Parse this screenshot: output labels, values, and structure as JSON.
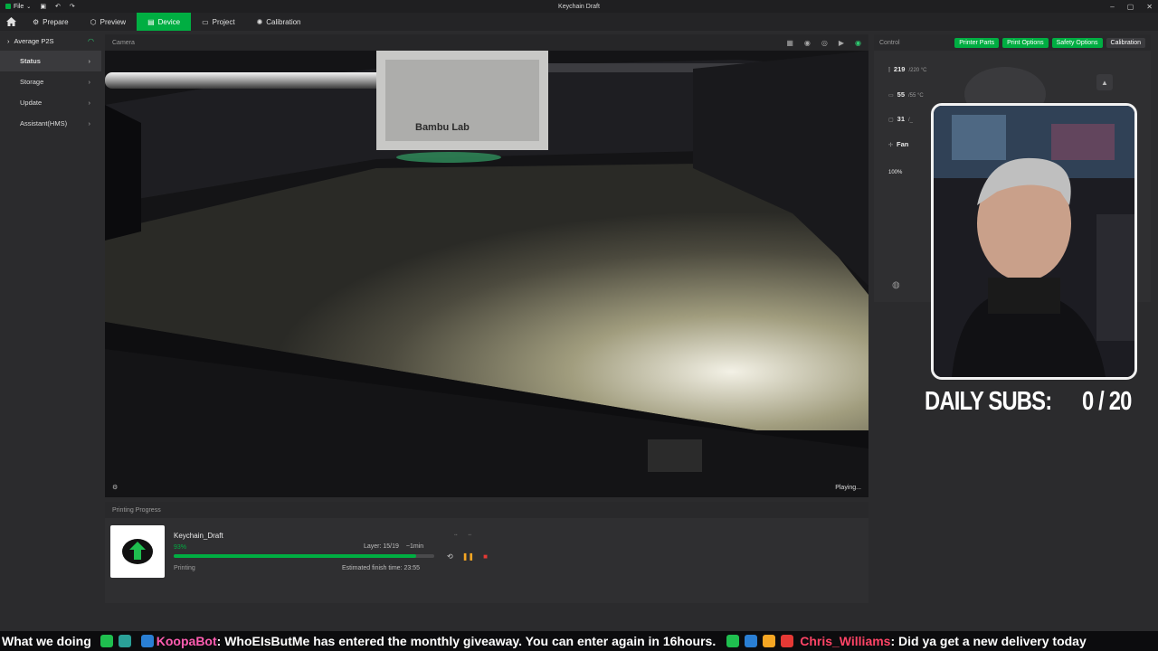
{
  "window": {
    "title": "Keychain Draft",
    "menu_label": "File"
  },
  "nav": {
    "tabs": [
      {
        "label": "Prepare"
      },
      {
        "label": "Preview"
      },
      {
        "label": "Device"
      },
      {
        "label": "Project"
      },
      {
        "label": "Calibration"
      }
    ],
    "active_tab": "Device"
  },
  "sidebar": {
    "device_name": "Average P2S",
    "items": [
      {
        "label": "Status"
      },
      {
        "label": "Storage"
      },
      {
        "label": "Update"
      },
      {
        "label": "Assistant(HMS)"
      }
    ]
  },
  "camera": {
    "header": "Camera",
    "brand": "Bambu Lab",
    "status": "Playing..."
  },
  "progress": {
    "header": "Printing Progress",
    "job_name": "Keychain_Draft",
    "percent": "93%",
    "percent_value": 93,
    "layer": "Layer: 15/19",
    "remaining": "~1min",
    "status": "Printing",
    "finish": "Estimated finish time: 23:55"
  },
  "control": {
    "header": "Control",
    "tabs": [
      "Printer Parts",
      "Print Options",
      "Safety Options",
      "Calibration"
    ],
    "nozzle_temp": "219",
    "nozzle_target": "/220 °C",
    "bed_temp": "55",
    "bed_target": "/55 °C",
    "chamber_temp": "31",
    "chamber_unit": "/_",
    "fan_label": "Fan",
    "fan_speed": "100%"
  },
  "overlay": {
    "subs_label": "DAILY SUBS:",
    "subs_value": "0 / 20"
  },
  "ticker": {
    "lead": "What we doing",
    "user1": "KoopaBot",
    "msg1": ": WhoEIsButMe has entered the monthly giveaway. You can enter again in 16hours.",
    "user2": "Chris_Williams",
    "msg2": ": Did ya get a new delivery today"
  },
  "colors": {
    "accent": "#00ae42",
    "panel": "#2f2f31",
    "background": "#2b2b2d"
  }
}
